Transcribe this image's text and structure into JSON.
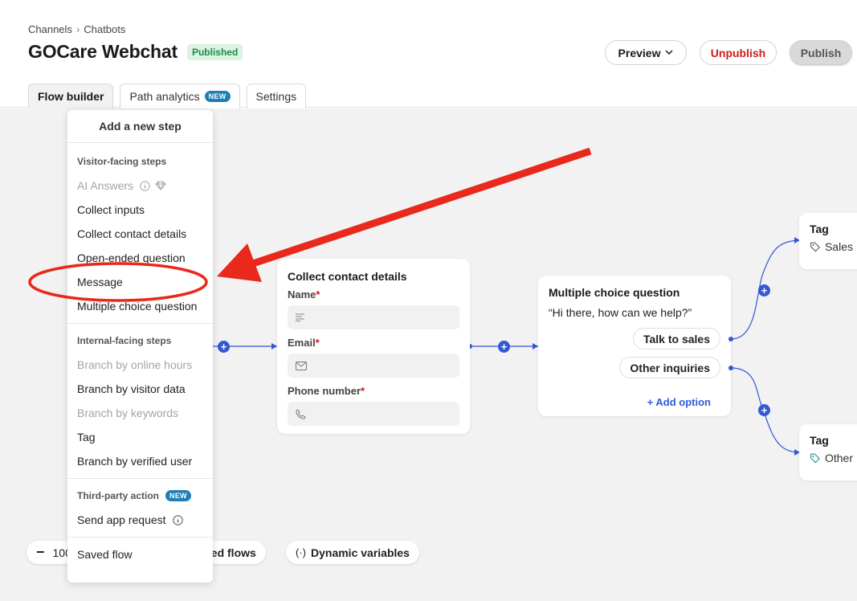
{
  "breadcrumb": {
    "item1": "Channels",
    "separator": "›",
    "item2": "Chatbots"
  },
  "title": "GOCare Webchat",
  "status_badge": "Published",
  "actions": {
    "preview": "Preview",
    "unpublish": "Unpublish",
    "publish": "Publish"
  },
  "tabs": [
    {
      "label": "Flow builder",
      "active": true
    },
    {
      "label": "Path analytics",
      "badge": "NEW"
    },
    {
      "label": "Settings"
    }
  ],
  "menu": {
    "title": "Add a new step",
    "visitor_section": "Visitor-facing steps",
    "visitor_items": [
      "AI Answers",
      "Collect inputs",
      "Collect contact details",
      "Open-ended question",
      "Message",
      "Multiple choice question"
    ],
    "internal_section": "Internal-facing steps",
    "internal_items": [
      "Branch by online hours",
      "Branch by visitor data",
      "Branch by keywords",
      "Tag",
      "Branch by verified user"
    ],
    "third_party_section": "Third-party action",
    "third_party_badge": "NEW",
    "third_party_items": [
      "Send app request"
    ],
    "saved_flow": "Saved flow"
  },
  "contact_card": {
    "title": "Collect contact details",
    "fields": [
      {
        "label": "Name",
        "required": "*",
        "icon": "text-lines-icon"
      },
      {
        "label": "Email",
        "required": "*",
        "icon": "envelope-icon"
      },
      {
        "label": "Phone number",
        "required": "*",
        "icon": "phone-icon"
      }
    ]
  },
  "mcq_card": {
    "title": "Multiple choice question",
    "question": "“Hi there, how can we help?”",
    "options": [
      "Talk to sales",
      "Other inquiries"
    ],
    "add_option": "+ Add option"
  },
  "tags": [
    {
      "title": "Tag",
      "value": "Sales"
    },
    {
      "title": "Tag",
      "value": "Other"
    }
  ],
  "bottom": {
    "zoom_partial": "100",
    "saved_flows_partial": "ved flows",
    "dynamic_variables": "Dynamic variables"
  },
  "colors": {
    "accent": "#3457d5",
    "danger": "#d11a1a",
    "annotation": "#e8291c",
    "success": "#1f8a4c"
  }
}
